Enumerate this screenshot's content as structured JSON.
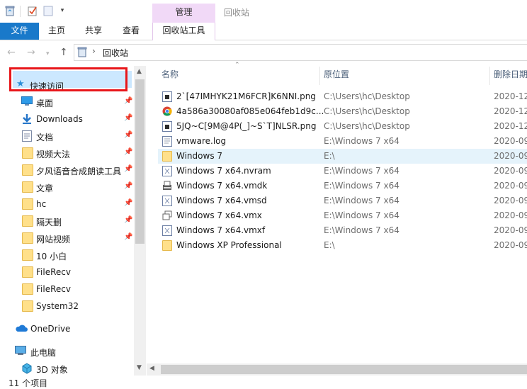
{
  "title_bar": {
    "context_tab_label": "管理",
    "window_title": "回收站"
  },
  "ribbon": {
    "tabs": [
      {
        "label": "文件"
      },
      {
        "label": "主页"
      },
      {
        "label": "共享"
      },
      {
        "label": "查看"
      },
      {
        "label": "回收站工具"
      }
    ],
    "accent_color": "#1979ca",
    "context_color": "#f1d9f7"
  },
  "address_bar": {
    "path": "回收站",
    "separator": "›"
  },
  "nav_pane": {
    "quick_access": "快速访问",
    "items": [
      {
        "label": "桌面",
        "icon": "desktop-icon",
        "pinned": true
      },
      {
        "label": "Downloads",
        "icon": "download-icon",
        "pinned": true
      },
      {
        "label": "文档",
        "icon": "document-icon",
        "pinned": true
      },
      {
        "label": "视频大法",
        "icon": "folder-icon",
        "pinned": true
      },
      {
        "label": "夕风语音合成朗读工具",
        "icon": "folder-icon",
        "pinned": true
      },
      {
        "label": "文章",
        "icon": "folder-icon",
        "pinned": true
      },
      {
        "label": "hc",
        "icon": "folder-icon",
        "pinned": true
      },
      {
        "label": "隔天删",
        "icon": "folder-icon",
        "pinned": true
      },
      {
        "label": "网站视频",
        "icon": "folder-icon",
        "pinned": true
      },
      {
        "label": "10 小白",
        "icon": "folder-icon",
        "pinned": false
      },
      {
        "label": "FileRecv",
        "icon": "folder-icon",
        "pinned": false
      },
      {
        "label": "FileRecv",
        "icon": "folder-icon",
        "pinned": false
      },
      {
        "label": "System32",
        "icon": "folder-icon",
        "pinned": false
      }
    ],
    "onedrive": "OneDrive",
    "this_pc": "此电脑",
    "objects_3d": "3D 对象"
  },
  "file_list": {
    "columns": {
      "name": "名称",
      "location": "原位置",
      "deleted": "删除日期"
    },
    "rows": [
      {
        "name": "2`[47IMHYK21M6FCR]K6NNI.png",
        "location": "C:\\Users\\hc\\Desktop",
        "date": "2020-12",
        "icon": "image-file-icon"
      },
      {
        "name": "4a586a30080af085e064feb1d9c...",
        "location": "C:\\Users\\hc\\Desktop",
        "date": "2020-12",
        "icon": "chrome-icon"
      },
      {
        "name": "5JQ~C[9M@4P(_]~S`T]NLSR.png",
        "location": "C:\\Users\\hc\\Desktop",
        "date": "2020-12",
        "icon": "image-file-icon"
      },
      {
        "name": "vmware.log",
        "location": "E:\\Windows 7 x64",
        "date": "2020-09",
        "icon": "text-file-icon"
      },
      {
        "name": "Windows 7",
        "location": "E:\\",
        "date": "2020-09",
        "icon": "folder-icon",
        "selected": true
      },
      {
        "name": "Windows 7 x64.nvram",
        "location": "E:\\Windows 7 x64",
        "date": "2020-09",
        "icon": "file-icon"
      },
      {
        "name": "Windows 7 x64.vmdk",
        "location": "E:\\Windows 7 x64",
        "date": "2020-09",
        "icon": "disk-file-icon"
      },
      {
        "name": "Windows 7 x64.vmsd",
        "location": "E:\\Windows 7 x64",
        "date": "2020-09",
        "icon": "file-icon"
      },
      {
        "name": "Windows 7 x64.vmx",
        "location": "E:\\Windows 7 x64",
        "date": "2020-09",
        "icon": "vm-file-icon"
      },
      {
        "name": "Windows 7 x64.vmxf",
        "location": "E:\\Windows 7 x64",
        "date": "2020-09",
        "icon": "file-icon"
      },
      {
        "name": "Windows XP Professional",
        "location": "E:\\",
        "date": "2020-09",
        "icon": "folder-icon"
      }
    ]
  },
  "status_bar": {
    "item_count": "11 个项目"
  }
}
